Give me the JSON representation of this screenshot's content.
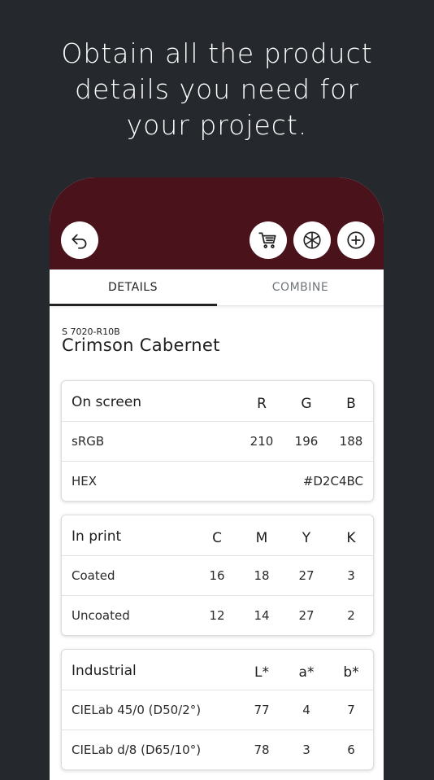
{
  "headline": [
    "Obtain all the product",
    "details you need for",
    "your project."
  ],
  "colors": {
    "background": "#25282c",
    "appbar": "#4a131c",
    "card_bg": "#ffffff"
  },
  "icons": {
    "back": "undo-arrow-icon",
    "cart": "cart-icon",
    "wheel": "color-wheel-icon",
    "add": "plus-circle-icon"
  },
  "tabs": [
    {
      "label": "DETAILS",
      "active": true
    },
    {
      "label": "COMBINE",
      "active": false
    }
  ],
  "color": {
    "code": "S 7020-R10B",
    "name": "Crimson Cabernet"
  },
  "on_screen": {
    "title": "On screen",
    "columns": [
      "R",
      "G",
      "B"
    ],
    "srgb": {
      "label": "sRGB",
      "values": [
        "210",
        "196",
        "188"
      ]
    },
    "hex": {
      "label": "HEX",
      "value": "#D2C4BC"
    }
  },
  "in_print": {
    "title": "In print",
    "columns": [
      "C",
      "M",
      "Y",
      "K"
    ],
    "rows": [
      {
        "label": "Coated",
        "values": [
          "16",
          "18",
          "27",
          "3"
        ]
      },
      {
        "label": "Uncoated",
        "values": [
          "12",
          "14",
          "27",
          "2"
        ]
      }
    ]
  },
  "industrial": {
    "title": "Industrial",
    "columns": [
      "L*",
      "a*",
      "b*"
    ],
    "rows": [
      {
        "label": "CIELab 45/0 (D50/2°)",
        "values": [
          "77",
          "4",
          "7"
        ]
      },
      {
        "label": "CIELab d/8 (D65/10°)",
        "values": [
          "78",
          "3",
          "6"
        ]
      }
    ]
  }
}
